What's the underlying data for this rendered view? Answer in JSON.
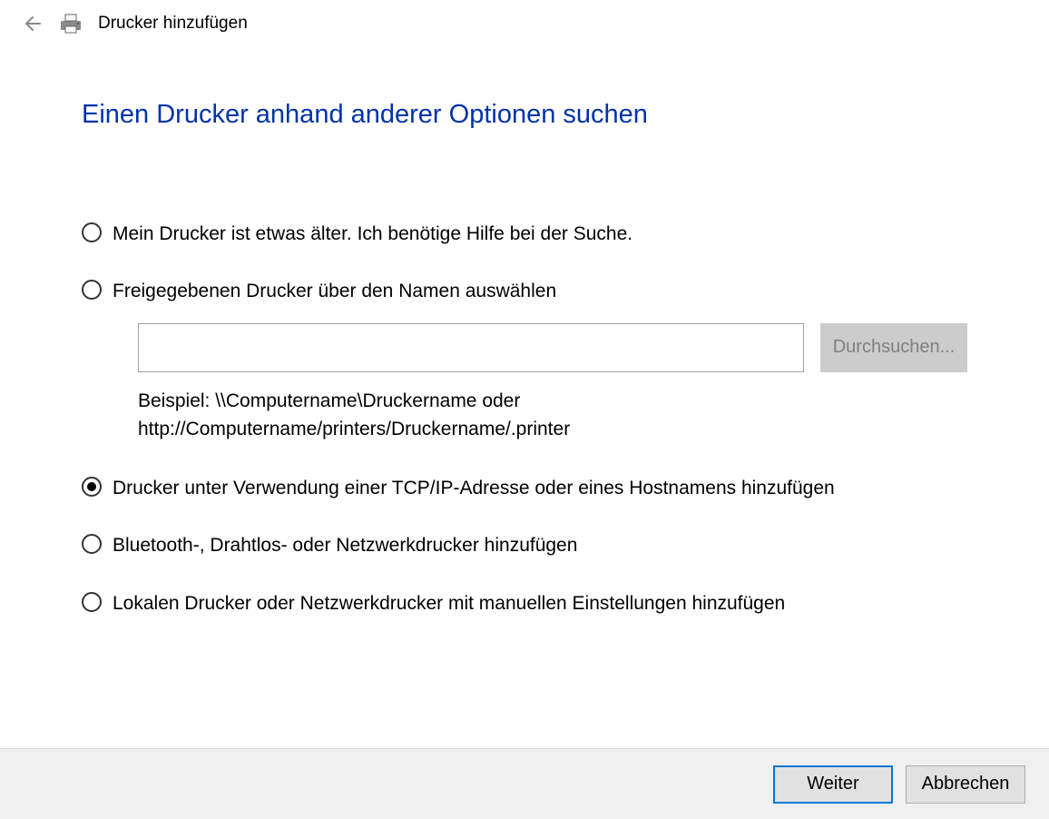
{
  "header": {
    "title": "Drucker hinzufügen"
  },
  "page": {
    "title": "Einen Drucker anhand anderer Optionen suchen"
  },
  "options": {
    "older": "Mein Drucker ist etwas älter. Ich benötige Hilfe bei der Suche.",
    "shared": "Freigegebenen Drucker über den Namen auswählen",
    "shared_input": "",
    "browse": "Durchsuchen...",
    "example": "Beispiel: \\\\Computername\\Druckername oder http://Computername/printers/Druckername/.printer",
    "tcpip": "Drucker unter Verwendung einer TCP/IP-Adresse oder eines Hostnamens hinzufügen",
    "bluetooth": "Bluetooth-, Drahtlos- oder Netzwerkdrucker hinzufügen",
    "local": "Lokalen Drucker oder Netzwerkdrucker mit manuellen Einstellungen hinzufügen"
  },
  "footer": {
    "next": "Weiter",
    "cancel": "Abbrechen"
  }
}
